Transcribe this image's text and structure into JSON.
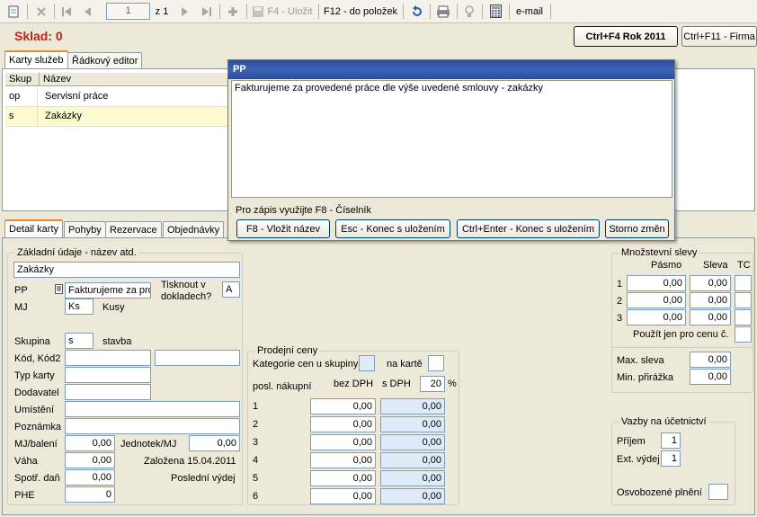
{
  "toolbar": {
    "page_value": "1",
    "page_of": "z 1",
    "save_label": "F4 - Uložit",
    "items_label": "F12 - do položek",
    "email_label": "e-mail"
  },
  "header": {
    "title": "Sklad: 0",
    "year_button": "Ctrl+F4 Rok 2011",
    "firm_button": "Ctrl+F11 - Firma"
  },
  "top_tabs": [
    "Karty služeb",
    "Řádkový editor"
  ],
  "grid": {
    "columns": [
      "Skup",
      "Název"
    ],
    "rows": [
      {
        "skup": "op",
        "nazev": "Servisní práce"
      },
      {
        "skup": "s",
        "nazev": "Zakázky"
      }
    ]
  },
  "popup": {
    "title": "PP",
    "text": "Fakturujeme za provedené práce dle výše uvedené smlouvy - zakázky",
    "hint": "Pro zápis využijte F8 - Číselník",
    "buttons": [
      "F8 - Vložit název",
      "Esc - Konec s uložením",
      "Ctrl+Enter - Konec s uložením",
      "Storno změn"
    ]
  },
  "bottom_tabs": [
    "Detail karty",
    "Pohyby",
    "Rezervace",
    "Objednávky"
  ],
  "detail": {
    "group_title": "Základní údaje - název atd.",
    "name": "Zakázky",
    "pp_label": "PP",
    "pp_value": "Fakturujeme za prov",
    "tisknout_label1": "Tisknout v",
    "tisknout_label2": "dokladech?",
    "tisknout_value": "A",
    "mj_label": "MJ",
    "mj_value": "Ks",
    "mj_text": "Kusy",
    "skupina_label": "Skupina",
    "skupina_value": "s",
    "skupina_text": "stavba",
    "kod_label": "Kód, Kód2",
    "typ_label": "Typ karty",
    "dodavatel_label": "Dodavatel",
    "umisteni_label": "Umístění",
    "poznamka_label": "Poznámka",
    "mjbaleni_label": "MJ/balení",
    "mjbaleni_value": "0,00",
    "jednotek_label": "Jednotek/MJ",
    "jednotek_value": "0,00",
    "vaha_label": "Váha",
    "vaha_value": "0,00",
    "zalozena": "Založena 15.04.2011",
    "spotr_label": "Spotř. daň",
    "spotr_value": "0,00",
    "posledni": "Poslední výdej",
    "phe_label": "PHE",
    "phe_value": "0"
  },
  "prices": {
    "title": "Prodejní ceny",
    "kategorie_label": "Kategorie cen u skupiny",
    "na_karte_label": "na kartě",
    "posl_label": "posl. nákupní",
    "bez_dph_label": "bez DPH",
    "s_dph_label": "s DPH",
    "dph_value": "20",
    "pct": "%",
    "rows": [
      {
        "n": "1",
        "bez": "0,00",
        "s": "0,00"
      },
      {
        "n": "2",
        "bez": "0,00",
        "s": "0,00"
      },
      {
        "n": "3",
        "bez": "0,00",
        "s": "0,00"
      },
      {
        "n": "4",
        "bez": "0,00",
        "s": "0,00"
      },
      {
        "n": "5",
        "bez": "0,00",
        "s": "0,00"
      },
      {
        "n": "6",
        "bez": "0,00",
        "s": "0,00"
      }
    ]
  },
  "discounts": {
    "title": "Množstevní slevy",
    "pasmo_label": "Pásmo",
    "sleva_label": "Sleva",
    "tc_label": "TC",
    "rows": [
      {
        "n": "1",
        "pasmo": "0,00",
        "sleva": "0,00"
      },
      {
        "n": "2",
        "pasmo": "0,00",
        "sleva": "0,00"
      },
      {
        "n": "3",
        "pasmo": "0,00",
        "sleva": "0,00"
      }
    ],
    "only_label": "Použít jen pro cenu č.",
    "max_label": "Max. sleva",
    "max_value": "0,00",
    "min_label": "Min. přirážka",
    "min_value": "0,00"
  },
  "accounting": {
    "title": "Vazby na účetnictví",
    "prijem_label": "Příjem",
    "prijem_value": "1",
    "vydej_label": "Ext. výdej",
    "vydej_value": "1",
    "osvob_label": "Osvobozené plnění"
  }
}
